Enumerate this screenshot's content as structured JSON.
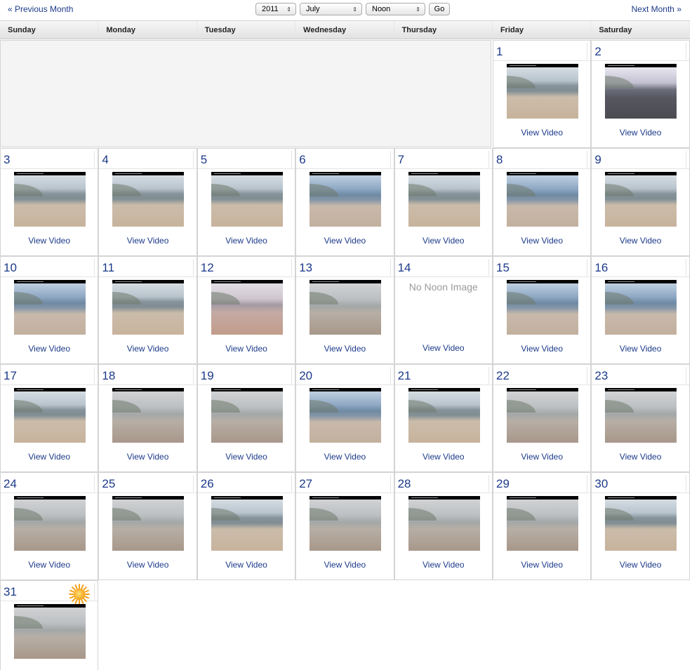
{
  "nav": {
    "prev_label": "« Previous Month",
    "next_label": "Next Month »"
  },
  "controls": {
    "year": "2011",
    "month": "July",
    "time": "Noon",
    "go_label": "Go"
  },
  "weekdays": [
    "Sunday",
    "Monday",
    "Tuesday",
    "Wednesday",
    "Thursday",
    "Friday",
    "Saturday"
  ],
  "view_video_label": "View Video",
  "no_image_label": "No Noon Image",
  "days": [
    {
      "day": "1",
      "col": 5,
      "row": 0,
      "tone": "default"
    },
    {
      "day": "2",
      "col": 6,
      "row": 0,
      "tone": "dark"
    },
    {
      "day": "3",
      "col": 0,
      "row": 1,
      "tone": "default"
    },
    {
      "day": "4",
      "col": 1,
      "row": 1,
      "tone": "default"
    },
    {
      "day": "5",
      "col": 2,
      "row": 1,
      "tone": "default"
    },
    {
      "day": "6",
      "col": 3,
      "row": 1,
      "tone": "blue"
    },
    {
      "day": "7",
      "col": 4,
      "row": 1,
      "tone": "default"
    },
    {
      "day": "8",
      "col": 5,
      "row": 1,
      "tone": "blue"
    },
    {
      "day": "9",
      "col": 6,
      "row": 1,
      "tone": "default"
    },
    {
      "day": "10",
      "col": 0,
      "row": 2,
      "tone": "blue"
    },
    {
      "day": "11",
      "col": 1,
      "row": 2,
      "tone": "default"
    },
    {
      "day": "12",
      "col": 2,
      "row": 2,
      "tone": "pink"
    },
    {
      "day": "13",
      "col": 3,
      "row": 2,
      "tone": "grey"
    },
    {
      "day": "14",
      "col": 4,
      "row": 2,
      "tone": "none",
      "no_image": true
    },
    {
      "day": "15",
      "col": 5,
      "row": 2,
      "tone": "blue"
    },
    {
      "day": "16",
      "col": 6,
      "row": 2,
      "tone": "blue"
    },
    {
      "day": "17",
      "col": 0,
      "row": 3,
      "tone": "default"
    },
    {
      "day": "18",
      "col": 1,
      "row": 3,
      "tone": "grey"
    },
    {
      "day": "19",
      "col": 2,
      "row": 3,
      "tone": "grey"
    },
    {
      "day": "20",
      "col": 3,
      "row": 3,
      "tone": "blue"
    },
    {
      "day": "21",
      "col": 4,
      "row": 3,
      "tone": "default"
    },
    {
      "day": "22",
      "col": 5,
      "row": 3,
      "tone": "grey"
    },
    {
      "day": "23",
      "col": 6,
      "row": 3,
      "tone": "grey"
    },
    {
      "day": "24",
      "col": 0,
      "row": 4,
      "tone": "grey"
    },
    {
      "day": "25",
      "col": 1,
      "row": 4,
      "tone": "grey"
    },
    {
      "day": "26",
      "col": 2,
      "row": 4,
      "tone": "default"
    },
    {
      "day": "27",
      "col": 3,
      "row": 4,
      "tone": "grey"
    },
    {
      "day": "28",
      "col": 4,
      "row": 4,
      "tone": "grey"
    },
    {
      "day": "29",
      "col": 5,
      "row": 4,
      "tone": "grey"
    },
    {
      "day": "30",
      "col": 6,
      "row": 4,
      "tone": "default"
    },
    {
      "day": "31",
      "col": 0,
      "row": 5,
      "tone": "grey",
      "today": true,
      "weather_icon": "sun-icon"
    }
  ]
}
